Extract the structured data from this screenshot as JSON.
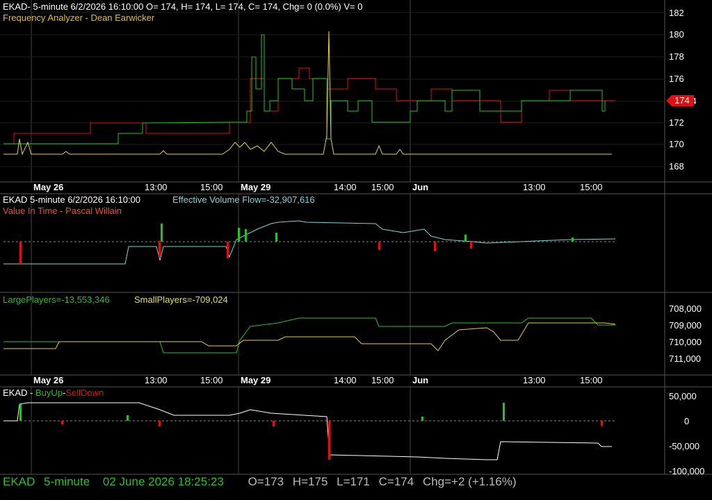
{
  "colors": {
    "background": "#000000",
    "grid": "#3a3a3a",
    "red": "#e01010",
    "green": "#22c422",
    "yellow": "#e8d040",
    "cyan": "#7fd7d7",
    "white": "#ffffff",
    "orange": "#f06030",
    "status_green": "#22c422"
  },
  "pane1": {
    "header": "EKAD- 5-minute 6/2/2026 16:10:00 O= 174, H= 174, L= 174, C= 174, Chg= 0 (0.0%) V= 0",
    "indicator": "Frequency Analyzer - Dean Earwicker",
    "yticks": [
      "182",
      "180",
      "178",
      "176",
      "174",
      "172",
      "170",
      "168"
    ],
    "last_price": "174"
  },
  "date_axis_1": [
    "May 26",
    "13:00",
    "15:00",
    "May 29",
    "14:00",
    "15:00",
    "Jun",
    "13:00",
    "15:00"
  ],
  "pane2": {
    "title_a": "EKAD 5-minute  6/2/2026 16:10:00",
    "title_b": "Effective Volume Flow=-32,907,616",
    "indicator": "Value In Time - Pascal Willain"
  },
  "pane3": {
    "large_label": "LargePlayers=-13,553,346",
    "small_label": "SmallPlayers=-709,024",
    "yticks": [
      "708,000",
      "709,000",
      "710,000",
      "711,000"
    ]
  },
  "date_axis_2": [
    "May 26",
    "13:00",
    "15:00",
    "May 29",
    "14:00",
    "15:00",
    "Jun",
    "13:00",
    "15:00"
  ],
  "pane4": {
    "ticker": "EKAD -",
    "buyup": "BuyUp",
    "dash": "-",
    "selldown": "SellDown",
    "yticks": [
      "50,000",
      "0",
      "-50,000",
      "-100,000"
    ]
  },
  "status": {
    "ticker": "EKAD",
    "interval": "5-minute",
    "datetime": "02 June 2026 18:25:23",
    "open": "O=173",
    "high": "H=175",
    "low": "L=171",
    "close": "C=174",
    "change": "Chg=+2 (+1.16%)"
  }
}
